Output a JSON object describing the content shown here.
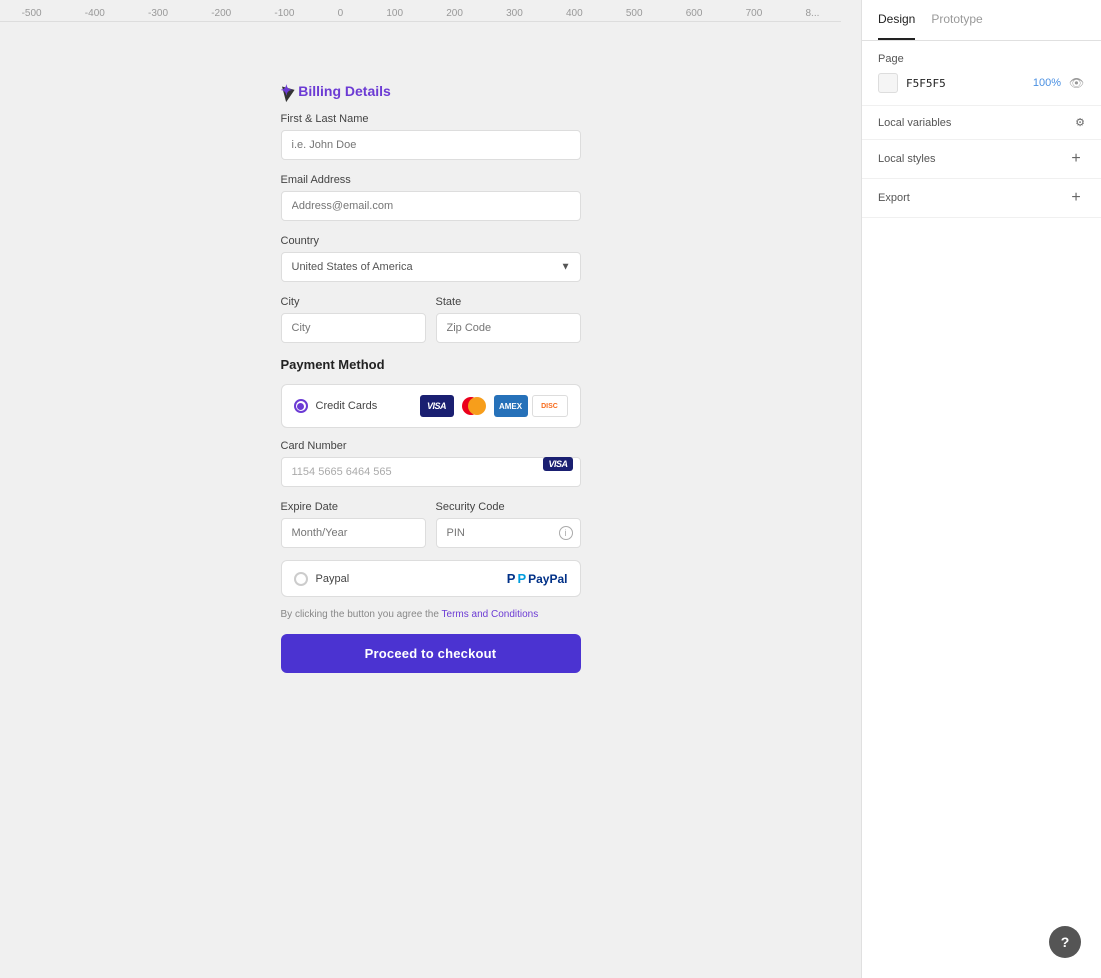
{
  "ruler": {
    "labels": [
      "-500",
      "-400",
      "-300",
      "-200",
      "-100",
      "0",
      "100",
      "200",
      "300",
      "400",
      "500",
      "600",
      "700",
      "8..."
    ]
  },
  "billing": {
    "title": "Billing Details",
    "title_icon": "✦",
    "fields": {
      "first_last_label": "First & Last Name",
      "first_last_placeholder": "i.e. John Doe",
      "email_label": "Email Address",
      "email_placeholder": "Address@email.com",
      "country_label": "Country",
      "country_value": "United States of America",
      "city_label": "City",
      "city_placeholder": "City",
      "state_label": "State",
      "zip_placeholder": "Zip Code"
    }
  },
  "payment": {
    "section_title": "Payment Method",
    "credit_cards_label": "Credit Cards",
    "card_number_label": "Card Number",
    "card_number_value": "1154 5665 6464 565",
    "expire_label": "Expire Date",
    "expire_placeholder": "Month/Year",
    "security_label": "Security Code",
    "security_placeholder": "PIN",
    "paypal_label": "Paypal"
  },
  "terms": {
    "text": "By clicking the button you agree the ",
    "link_text": "Terms and Conditions"
  },
  "checkout_btn": "Proceed to checkout",
  "panel": {
    "tabs": [
      "Design",
      "Prototype"
    ],
    "active_tab": "Design",
    "page_label": "Page",
    "page_color": "F5F5F5",
    "page_opacity": "100%",
    "local_variables_label": "Local variables",
    "local_styles_label": "Local styles",
    "export_label": "Export"
  },
  "help": "?"
}
